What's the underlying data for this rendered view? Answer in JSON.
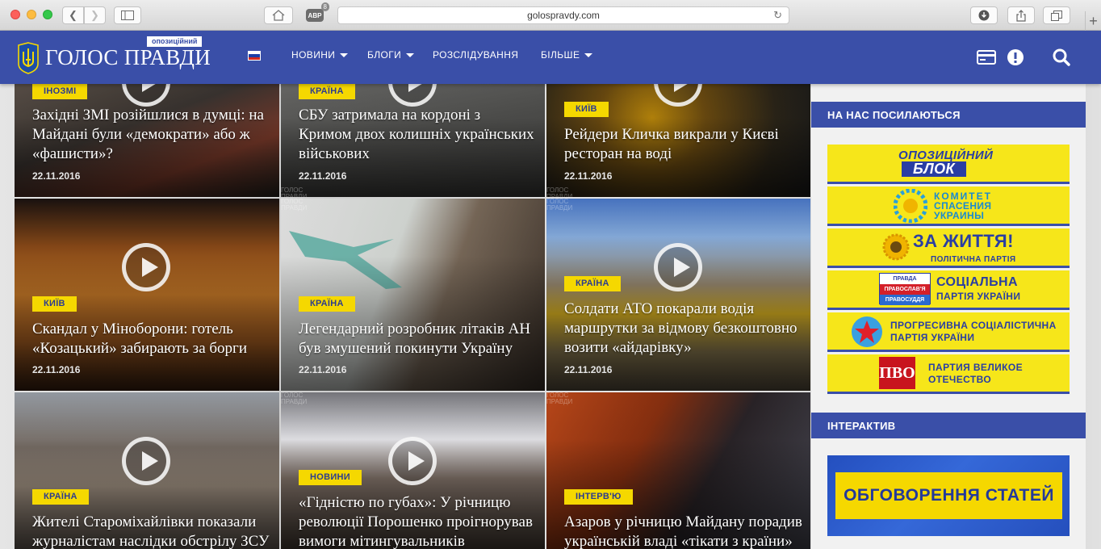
{
  "browser": {
    "url": "golospravdy.com",
    "adblock_label": "ABP",
    "adblock_count": "8"
  },
  "site": {
    "logo_title": "ГОЛОС ПРАВДИ",
    "logo_badge": "опозиційний",
    "nav": [
      {
        "label": "НОВИНИ"
      },
      {
        "label": "БЛОГИ"
      },
      {
        "label": "РОЗСЛІДУВАННЯ"
      },
      {
        "label": "БІЛЬШЕ"
      }
    ],
    "colors": {
      "brand_blue": "#3a4fa8",
      "accent_yellow": "#f5d800"
    }
  },
  "articles": [
    {
      "tag": "ІНОЗМІ",
      "title": "Західні ЗМІ розійшлися в думці: на Майдані були «демократи» або ж «фашисти»?",
      "date": "22.11.2016"
    },
    {
      "tag": "КРАЇНА",
      "title": "СБУ затримала на кордоні з Кримом двох колишніх українських військових",
      "date": "22.11.2016"
    },
    {
      "tag": "КИЇВ",
      "title": "Рейдери Кличка викрали у Києві ресторан на воді",
      "date": "22.11.2016"
    },
    {
      "tag": "КИЇВ",
      "title": "Скандал у Міноборони: готель «Козацький» забирають за борги",
      "date": "22.11.2016"
    },
    {
      "tag": "КРАЇНА",
      "title": "Легендарний розробник літаків АН був змушений покинути Україну",
      "date": "22.11.2016"
    },
    {
      "tag": "КРАЇНА",
      "title": "Солдати АТО покарали водія маршрутки за відмову безкоштовно возити «айдарівку»",
      "date": "22.11.2016"
    },
    {
      "tag": "КРАЇНА",
      "title": "Жителі Староміхайлівки показали журналістам наслідки обстрілу ЗСУ",
      "date": ""
    },
    {
      "tag": "НОВИНИ",
      "title": "«Гідністю по губах»: У річницю революції Порошенко проігнорував вимоги мітингувальників",
      "date": ""
    },
    {
      "tag": "ІНТЕРВ'Ю",
      "title": "Азаров у річницю Майдану порадив українській владі «тікати з країни»",
      "date": ""
    }
  ],
  "sidebar": {
    "links_heading": "НА НАС ПОСИЛАЮТЬСЯ",
    "partners": [
      {
        "line1": "ОПОЗИЦІЙНИЙ",
        "line2": "БЛОК"
      },
      {
        "line1": "КОМИТЕТ",
        "line2": "СПАСЕНИЯ",
        "line3": "УКРАИНЫ"
      },
      {
        "line1": "ЗА ЖИТТЯ!",
        "line2": "ПОЛІТИЧНА ПАРТІЯ"
      },
      {
        "line1": "СОЦІАЛЬНА",
        "line2": "ПАРТІЯ УКРАЇНИ",
        "logo1": "ПРАВДА",
        "logo2": "ПРАВОСЛАВ'Я",
        "logo3": "ПРАВОСУДДЯ"
      },
      {
        "line1": "ПРОГРЕСИВНА СОЦІАЛІСТИЧНА",
        "line2": "ПАРТІЯ УКРАЇНИ"
      },
      {
        "line1": "ПАРТИЯ ВЕЛИКОЕ",
        "line2": "ОТЕЧЕСТВО",
        "logo": "ПВО"
      }
    ],
    "interactive_heading": "ІНТЕРАКТИВ",
    "interactive_banner": "ОБГОВОРЕННЯ СТАТЕЙ"
  },
  "watermark": [
    "ГОЛОС",
    "ПРАВДИ"
  ]
}
